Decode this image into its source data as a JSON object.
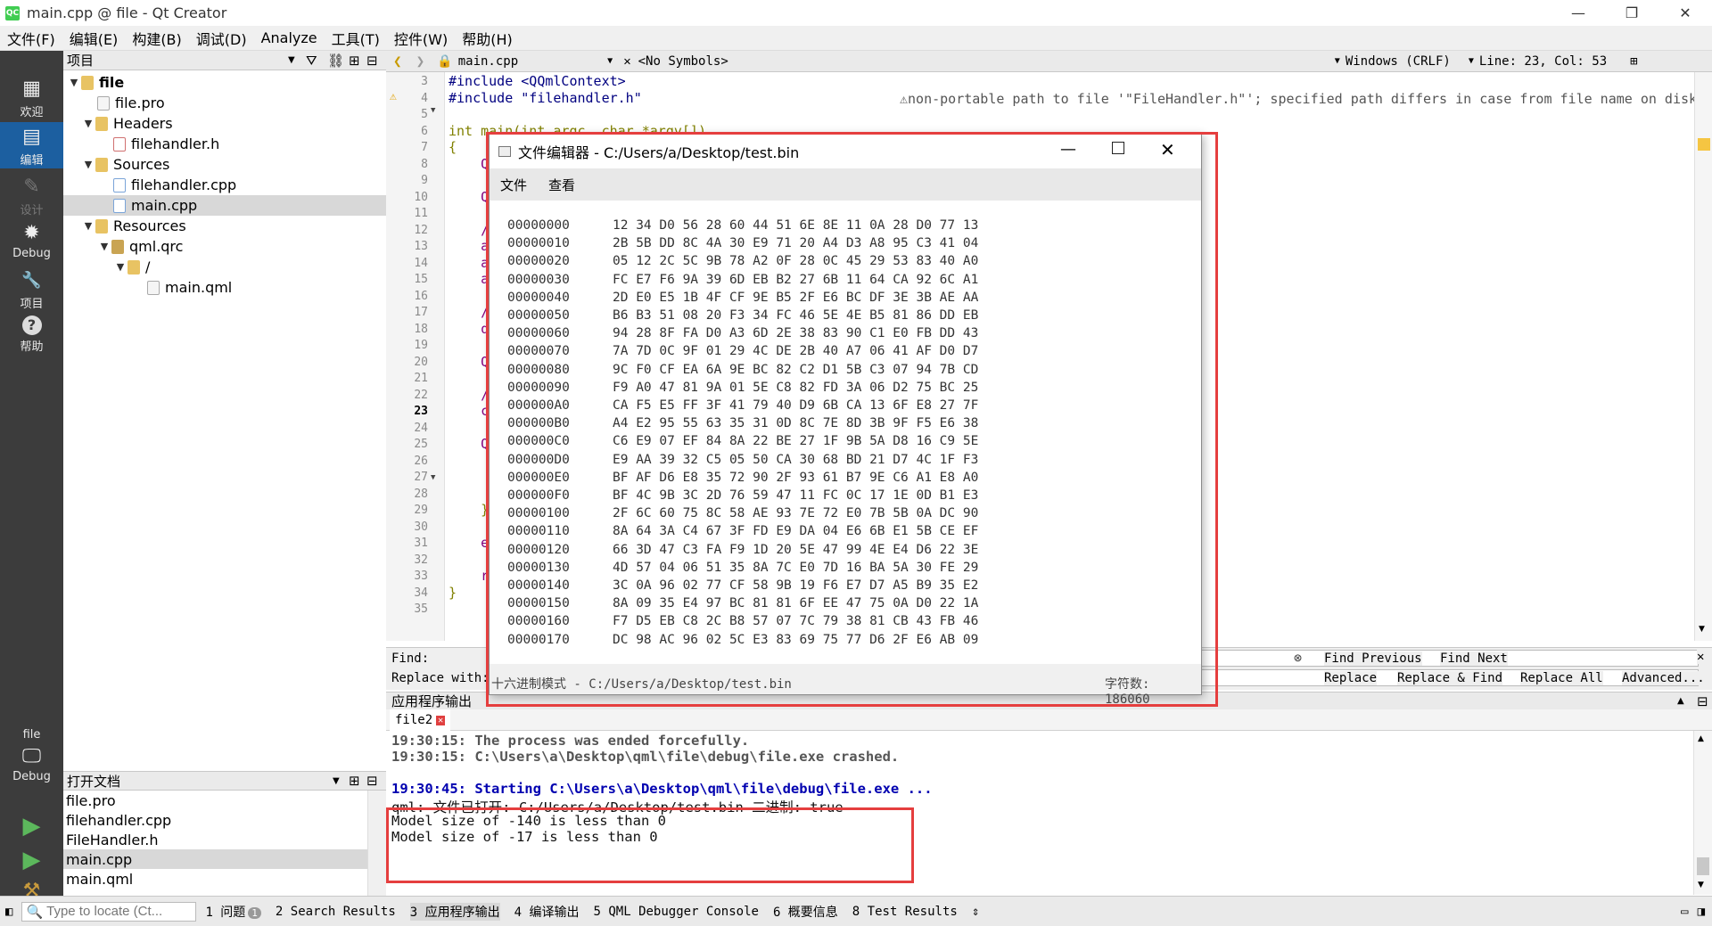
{
  "window": {
    "title": "main.cpp @ file - Qt Creator",
    "logo": "QC",
    "minimize": "—",
    "maximize": "❐",
    "close": "✕"
  },
  "menu": [
    "文件(F)",
    "编辑(E)",
    "构建(B)",
    "调试(D)",
    "Analyze",
    "工具(T)",
    "控件(W)",
    "帮助(H)"
  ],
  "modes": [
    {
      "label": "欢迎",
      "icon": "grid-icon",
      "glyph": "▦"
    },
    {
      "label": "编辑",
      "icon": "edit-icon",
      "glyph": "▤"
    },
    {
      "label": "设计",
      "icon": "design-icon",
      "glyph": "✎"
    },
    {
      "label": "Debug",
      "icon": "bug-icon",
      "glyph": "✹"
    },
    {
      "label": "项目",
      "icon": "wrench-icon",
      "glyph": "🔧"
    },
    {
      "label": "帮助",
      "icon": "help-icon",
      "glyph": "?"
    }
  ],
  "kit": {
    "name": "file",
    "mode": "Debug"
  },
  "project_panel": {
    "title": "项目"
  },
  "tree": [
    {
      "label": "file",
      "bold": true
    },
    {
      "label": "file.pro"
    },
    {
      "label": "Headers"
    },
    {
      "label": "filehandler.h"
    },
    {
      "label": "Sources"
    },
    {
      "label": "filehandler.cpp"
    },
    {
      "label": "main.cpp"
    },
    {
      "label": "Resources"
    },
    {
      "label": "qml.qrc"
    },
    {
      "label": "/"
    },
    {
      "label": "main.qml"
    }
  ],
  "open_docs": {
    "title": "打开文档",
    "items": [
      "file.pro",
      "filehandler.cpp",
      "FileHandler.h",
      "main.cpp",
      "main.qml"
    ]
  },
  "editor": {
    "file_tab": "main.cpp",
    "symbols": "<No Symbols>",
    "encoding": "Windows (CRLF)",
    "position": "Line: 23, Col: 53",
    "warning": "⚠non-portable path to file '\"FileHandler.h\"'; specified path differs in case from file name on disk",
    "lines": [
      {
        "n": "3",
        "t": "#include <QQmlContext>"
      },
      {
        "n": "4",
        "t": "#include \"filehandler.h\""
      },
      {
        "n": "5",
        "t": ""
      },
      {
        "n": "6",
        "t": "int main(int argc, char *argv[])"
      },
      {
        "n": "7",
        "t": "{"
      },
      {
        "n": "8",
        "t": "    Q"
      },
      {
        "n": "9",
        "t": ""
      },
      {
        "n": "10",
        "t": "    Q"
      },
      {
        "n": "11",
        "t": ""
      },
      {
        "n": "12",
        "t": "    /"
      },
      {
        "n": "13",
        "t": "    a"
      },
      {
        "n": "14",
        "t": "    a"
      },
      {
        "n": "15",
        "t": "    a"
      },
      {
        "n": "16",
        "t": ""
      },
      {
        "n": "17",
        "t": "    /"
      },
      {
        "n": "18",
        "t": "    q"
      },
      {
        "n": "19",
        "t": ""
      },
      {
        "n": "20",
        "t": "    Q"
      },
      {
        "n": "21",
        "t": ""
      },
      {
        "n": "22",
        "t": "    /"
      },
      {
        "n": "23",
        "t": "    c"
      },
      {
        "n": "24",
        "t": ""
      },
      {
        "n": "25",
        "t": "    Q"
      },
      {
        "n": "26",
        "t": ""
      },
      {
        "n": "27",
        "t": ""
      },
      {
        "n": "28",
        "t": ""
      },
      {
        "n": "29",
        "t": "    }"
      },
      {
        "n": "30",
        "t": ""
      },
      {
        "n": "31",
        "t": "    e"
      },
      {
        "n": "32",
        "t": ""
      },
      {
        "n": "33",
        "t": "    r"
      },
      {
        "n": "34",
        "t": "}"
      },
      {
        "n": "35",
        "t": ""
      }
    ]
  },
  "find": {
    "find_label": "Find:",
    "replace_label": "Replace with:",
    "find_previous": "Find Previous",
    "find_next": "Find Next",
    "replace": "Replace",
    "replace_find": "Replace & Find",
    "replace_all": "Replace All",
    "advanced": "Advanced..."
  },
  "output": {
    "title": "应用程序输出",
    "tab": "file2",
    "lines": [
      {
        "t": "19:30:15: The process was ended forcefully.",
        "style": "normal"
      },
      {
        "t": "19:30:15: C:\\Users\\a\\Desktop\\qml\\file\\debug\\file.exe crashed.",
        "style": "normal"
      },
      {
        "t": "",
        "style": "normal"
      },
      {
        "t": "19:30:45: Starting C:\\Users\\a\\Desktop\\qml\\file\\debug\\file.exe ...",
        "style": "blue"
      },
      {
        "t": "qml: 文件已打开: C:/Users/a/Desktop/test.bin 二进制: true",
        "style": "plain"
      },
      {
        "t": "Model size of -140 is less than 0",
        "style": "plain"
      },
      {
        "t": "Model size of -17 is less than 0",
        "style": "plain"
      }
    ]
  },
  "statusbar": {
    "locate_placeholder": "Type to locate (Ct...",
    "tabs": [
      "1 问题",
      "2 Search Results",
      "3 应用程序输出",
      "4 编译输出",
      "5 QML Debugger Console",
      "6 概要信息",
      "8 Test Results"
    ],
    "issues_count": "1"
  },
  "dialog": {
    "title": "文件编辑器 - C:/Users/a/Desktop/test.bin",
    "menu": [
      "文件",
      "查看"
    ],
    "status_left": "十六进制模式 - C:/Users/a/Desktop/test.bin",
    "status_right": "字符数: 186060",
    "rows": [
      {
        "o": "00000000",
        "b": "12 34 D0 56 28 60 44 51 6E 8E 11 0A 28 D0 77 13"
      },
      {
        "o": "00000010",
        "b": "2B 5B DD 8C 4A 30 E9 71 20 A4 D3 A8 95 C3 41 04"
      },
      {
        "o": "00000020",
        "b": "05 12 2C 5C 9B 78 A2 0F 28 0C 45 29 53 83 40 A0"
      },
      {
        "o": "00000030",
        "b": "FC E7 F6 9A 39 6D EB B2 27 6B 11 64 CA 92 6C A1"
      },
      {
        "o": "00000040",
        "b": "2D E0 E5 1B 4F CF 9E B5 2F E6 BC DF 3E 3B AE AA"
      },
      {
        "o": "00000050",
        "b": "B6 B3 51 08 20 F3 34 FC 46 5E 4E B5 81 86 DD EB"
      },
      {
        "o": "00000060",
        "b": "94 28 8F FA D0 A3 6D 2E 38 83 90 C1 E0 FB DD 43"
      },
      {
        "o": "00000070",
        "b": "7A 7D 0C 9F 01 29 4C DE 2B 40 A7 06 41 AF D0 D7"
      },
      {
        "o": "00000080",
        "b": "9C F0 CF EA 6A 9E BC 82 C2 D1 5B C3 07 94 7B CD"
      },
      {
        "o": "00000090",
        "b": "F9 A0 47 81 9A 01 5E C8 82 FD 3A 06 D2 75 BC 25"
      },
      {
        "o": "000000A0",
        "b": "CA F5 E5 FF 3F 41 79 40 D9 6B CA 13 6F E8 27 7F"
      },
      {
        "o": "000000B0",
        "b": "A4 E2 95 55 63 35 31 0D 8C 7E 8D 3B 9F F5 E6 38"
      },
      {
        "o": "000000C0",
        "b": "C6 E9 07 EF 84 8A 22 BE 27 1F 9B 5A D8 16 C9 5E"
      },
      {
        "o": "000000D0",
        "b": "E9 AA 39 32 C5 05 50 CA 30 68 BD 21 D7 4C 1F F3"
      },
      {
        "o": "000000E0",
        "b": "BF AF D6 E8 35 72 90 2F 93 61 B7 9E C6 A1 E8 A0"
      },
      {
        "o": "000000F0",
        "b": "BF 4C 9B 3C 2D 76 59 47 11 FC 0C 17 1E 0D B1 E3"
      },
      {
        "o": "00000100",
        "b": "2F 6C 60 75 8C 58 AE 93 7E 72 E0 7B 5B 0A DC 90"
      },
      {
        "o": "00000110",
        "b": "8A 64 3A C4 67 3F FD E9 DA 04 E6 6B E1 5B CE EF"
      },
      {
        "o": "00000120",
        "b": "66 3D 47 C3 FA F9 1D 20 5E 47 99 4E E4 D6 22 3E"
      },
      {
        "o": "00000130",
        "b": "4D 57 04 06 51 35 8A 7C E0 7D 16 BA 5A 30 FE 29"
      },
      {
        "o": "00000140",
        "b": "3C 0A 96 02 77 CF 58 9B 19 F6 E7 D7 A5 B9 35 E2"
      },
      {
        "o": "00000150",
        "b": "8A 09 35 E4 97 BC 81 81 6F EE 47 75 0A D0 22 1A"
      },
      {
        "o": "00000160",
        "b": "F7 D5 EB C8 2C B8 57 07 7C 79 38 81 CB 43 FB 46"
      },
      {
        "o": "00000170",
        "b": "DC 98 AC 96 02 5C E3 83 69 75 77 D6 2F E6 AB 09"
      }
    ]
  },
  "colors": {
    "accent": "#1c5fa0",
    "highlight": "#e53e3e",
    "modebar": "#3c3c3c"
  }
}
